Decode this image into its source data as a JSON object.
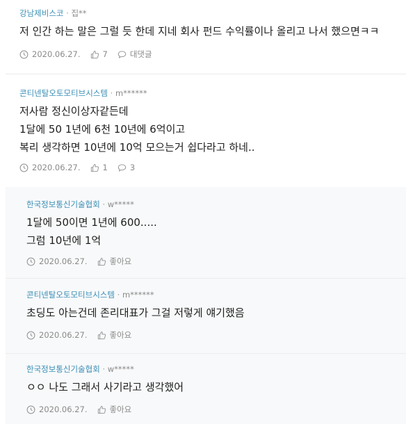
{
  "comments": [
    {
      "org": "강남제비스코",
      "user": "집**",
      "lines": [
        "저 인간 하는 말은 그럴 듯 한데 지네 회사 펀드 수익률이나 올리고 나서 했으면ㅋㅋ"
      ],
      "date": "2020.06.27.",
      "likes": "7",
      "replies": "대댓글"
    },
    {
      "org": "콘티넨탈오토모티브시스템",
      "user": "m******",
      "lines": [
        "저사람 정신이상자같든데",
        "1달에 50 1년에 6천 10년에 6억이고",
        "복리 생각하면 10년에 10억 모으는거 쉽다라고 하네.."
      ],
      "date": "2020.06.27.",
      "likes": "1",
      "replies": "3"
    },
    {
      "org": "한국정보통신기술협회",
      "user": "w*****",
      "lines": [
        "1달에 50이면 1년에 600.....",
        "그럼 10년에 1억"
      ],
      "date": "2020.06.27.",
      "likes": "좋아요"
    },
    {
      "org": "콘티넨탈오토모티브시스템",
      "user": "m******",
      "lines": [
        "초딩도 아는건데 존리대표가 그걸 저렇게 얘기했음"
      ],
      "date": "2020.06.27.",
      "likes": "좋아요"
    },
    {
      "org": "한국정보통신기술협회",
      "user": "w*****",
      "lines": [
        "ㅇㅇ 나도 그래서 사기라고 생각했어"
      ],
      "date": "2020.06.27.",
      "likes": "좋아요"
    }
  ],
  "separator": " · ",
  "colors": {
    "org": "#3b8fb6",
    "meta": "#8a8a8a",
    "reply_bg": "#f8f9fa"
  },
  "icons": {
    "date": "clock-icon",
    "like": "thumbs-up-icon",
    "reply": "speech-bubble-icon"
  }
}
